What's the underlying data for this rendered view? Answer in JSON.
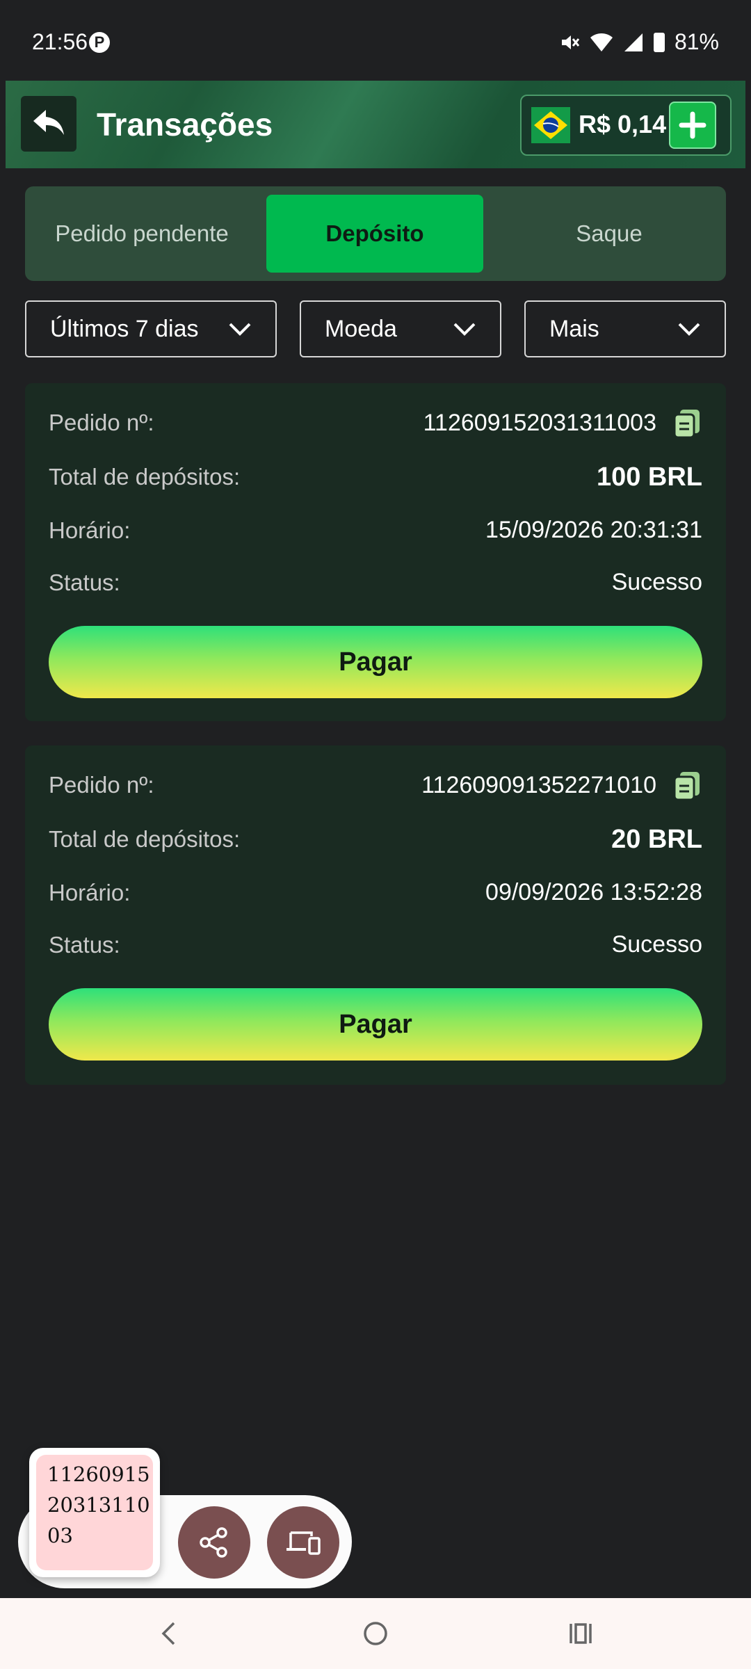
{
  "status": {
    "time": "21:56",
    "battery": "81%"
  },
  "header": {
    "title": "Transações",
    "balance": "R$ 0,14"
  },
  "tabs": [
    {
      "label": "Pedido pendente"
    },
    {
      "label": "Depósito"
    },
    {
      "label": "Saque"
    }
  ],
  "filters": {
    "period": "Últimos 7 dias",
    "currency": "Moeda",
    "more": "Mais"
  },
  "labels": {
    "order": "Pedido nº:",
    "total": "Total de depósitos:",
    "time": "Horário:",
    "status": "Status:",
    "pay": "Pagar"
  },
  "transactions": [
    {
      "order_no": "112609152031311003",
      "total": "100 BRL",
      "time": "15/09/2026 20:31:31",
      "status": "Sucesso"
    },
    {
      "order_no": "112609091352271010",
      "total": "20 BRL",
      "time": "09/09/2026 13:52:28",
      "status": "Sucesso"
    }
  ],
  "clipboard": {
    "text": "112609152031311003"
  }
}
